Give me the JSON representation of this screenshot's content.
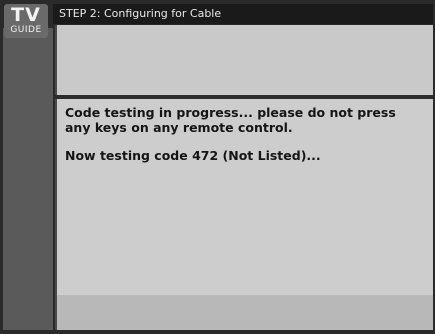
{
  "logo": {
    "top": "TV",
    "bottom": "GUIDE"
  },
  "header": {
    "title": "STEP 2: Configuring for Cable"
  },
  "main": {
    "message": "Code testing in progress... please do not press any keys on any remote control.",
    "status": "Now testing code 472 (Not Listed)..."
  }
}
